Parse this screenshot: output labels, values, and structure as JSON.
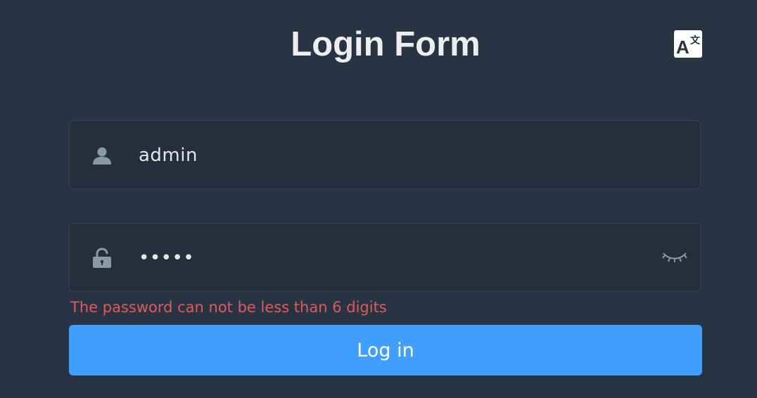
{
  "title": "Login Form",
  "language_button": {
    "icon": "translate-icon",
    "color": "#ffffff"
  },
  "username": {
    "icon": "user-icon",
    "value": "admin"
  },
  "password": {
    "icon": "lock-icon",
    "value": "admin",
    "toggle_icon": "eye-closed-icon"
  },
  "error": {
    "text": "The password can not be less than 6 digits",
    "color": "#e05a5a"
  },
  "login_button": {
    "label": "Log in",
    "color": "#409eff"
  },
  "colors": {
    "background": "#283443",
    "field_background": "#262d3c",
    "icon": "#889aa4"
  }
}
